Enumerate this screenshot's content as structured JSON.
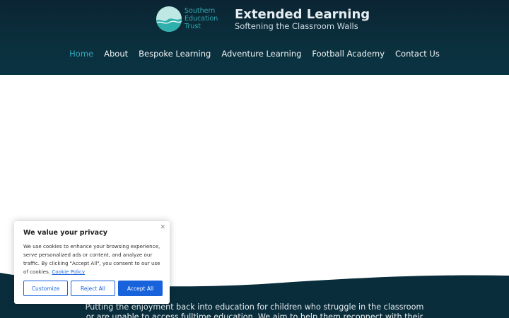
{
  "header": {
    "logo": {
      "trust_lines": [
        "Southern",
        "Education",
        "Trust"
      ],
      "icon": "wave-circle-logo-icon"
    },
    "title": "Extended Learning",
    "tagline": "Softening the Classroom Walls"
  },
  "nav": {
    "items": [
      {
        "label": "Home",
        "active": true
      },
      {
        "label": "About"
      },
      {
        "label": "Bespoke Learning"
      },
      {
        "label": "Adventure Learning"
      },
      {
        "label": "Football Academy"
      },
      {
        "label": "Contact Us"
      }
    ]
  },
  "intro": {
    "text": "Putting the enjoyment back into education for children who struggle in the classroom or are unable to access fulltime education. We aim to help them reconnect with their"
  },
  "cookie_banner": {
    "title": "We value your privacy",
    "body": "We use cookies to enhance your browsing experience, serve personalized ads or content, and analyze our traffic. By clicking \"Accept All\", you consent to our use of cookies.",
    "link": "Cookie Policy",
    "close_icon": "close-icon",
    "buttons": {
      "customize": "Customize",
      "reject": "Reject All",
      "accept": "Accept All"
    }
  },
  "colors": {
    "header_bg": "#0b2f3c",
    "nav_active": "#2fa9c0",
    "logo_teal": "#34b3b0",
    "cookie_accent": "#1863dc",
    "wave_dark": "#0a2d3c"
  }
}
